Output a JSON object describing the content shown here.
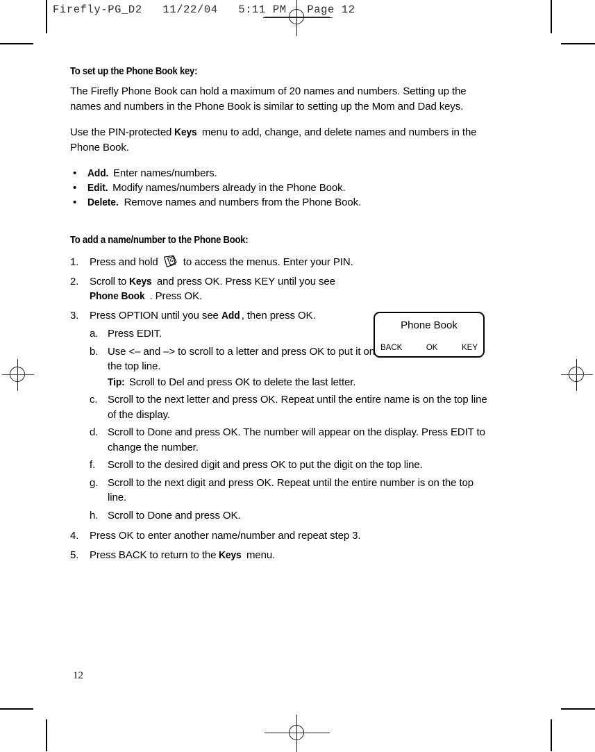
{
  "prepress": {
    "header": "Firefly-PG_D2   11/22/04   5:11 PM   Page 12"
  },
  "page": {
    "folio": "12"
  },
  "section1": {
    "heading": "To set up the Phone Book key:",
    "paragraph1": "The Firefly Phone Book can hold a maximum of 20 names and numbers. Setting up the names and numbers in the Phone Book is similar to setting up the Mom and Dad keys.",
    "paragraph2_part1": "Use the PIN-protected ",
    "paragraph2_bold": "Keys",
    "paragraph2_part2": " menu to add, change, and delete names and numbers in the Phone Book.",
    "bullets": [
      {
        "term": "Add.",
        "text": " Enter names/numbers."
      },
      {
        "term": "Edit.",
        "text": " Modify names/numbers already in the Phone Book."
      },
      {
        "term": "Delete.",
        "text": " Remove names and numbers from the Phone Book."
      }
    ]
  },
  "section2": {
    "heading": "To add a name/number to the Phone Book:",
    "steps": [
      {
        "marker": "1.",
        "pre": "Press and hold ",
        "icon": "firefly-phone-key-icon",
        "post": " to access the menus. Enter your PIN."
      },
      {
        "marker": "2.",
        "pre": "Scroll to ",
        "bold1": "Keys",
        "mid": " and press OK. Press KEY until you see ",
        "bold2": "Phone Book",
        "post": ". Press OK."
      },
      {
        "marker": "3.",
        "pre": "Press OPTION until you see ",
        "bold1": "Add",
        "post": ", then press OK."
      },
      {
        "marker": "4.",
        "text": "Press OK to enter another name/number and repeat step 3."
      },
      {
        "marker": "5.",
        "pre": "Press BACK to return to the ",
        "bold1": "Keys",
        "post": " menu."
      }
    ],
    "substeps": [
      {
        "marker": "a.",
        "text": "Press EDIT."
      },
      {
        "marker": "b.",
        "text": "Use <– and –> to scroll to a letter and press OK to put it on the top line.",
        "tip_label": "Tip:",
        "tip_text": "  Scroll to Del and press OK to delete the last letter."
      },
      {
        "marker": "c.",
        "text": "Scroll to the next letter and press OK. Repeat until the entire name is on the top line of the display."
      },
      {
        "marker": "d.",
        "text": "Scroll to Done and press OK. The number will appear on the display. Press EDIT to change the number."
      },
      {
        "marker": "f.",
        "text": "Scroll to the desired digit and press OK to put the digit on the top line."
      },
      {
        "marker": "g.",
        "text": "Scroll to the next digit and press OK. Repeat until the entire number is on the top line."
      },
      {
        "marker": "h.",
        "text": "Scroll to Done and press OK."
      }
    ]
  },
  "phone_display": {
    "title": "Phone Book",
    "softkey_left": "BACK",
    "softkey_center": "OK",
    "softkey_right": "KEY"
  },
  "colors": {
    "ink": "#000000",
    "prepress_ink": "#2b2b2b",
    "regmark": "#1a1a1a",
    "paper": "#ffffff"
  }
}
